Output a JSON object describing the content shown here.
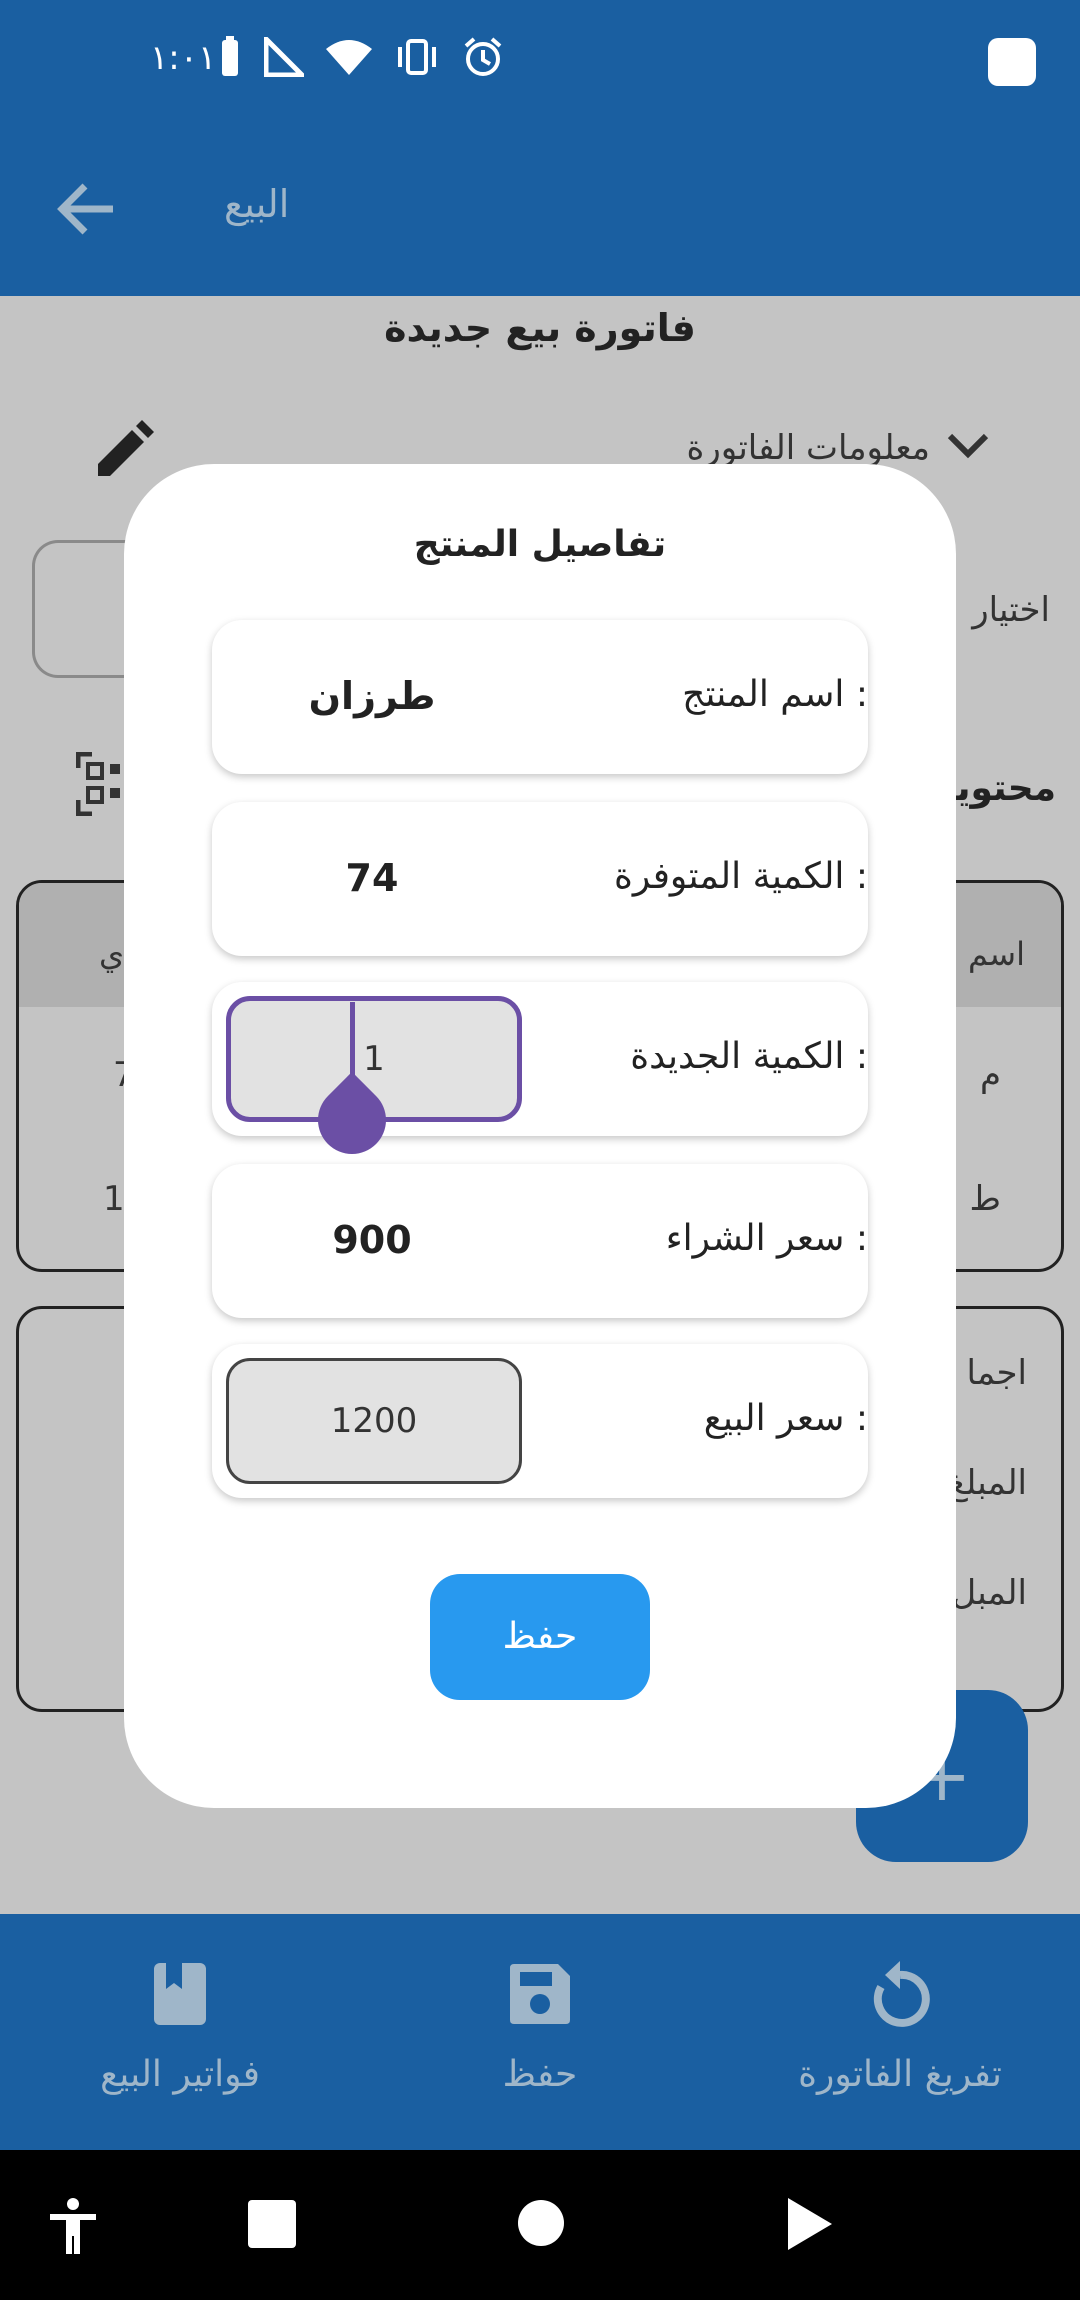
{
  "status_bar": {
    "time": "١:٠١"
  },
  "app_bar": {
    "title": "البيع"
  },
  "background": {
    "invoice_title": "فاتورة بيع جديدة",
    "invoice_info_label": "معلومات الفاتورة",
    "pick_label": "اختيار",
    "contents_label": "محتويا",
    "table": {
      "header_right": "اسم",
      "header_left": "ي",
      "rows": [
        {
          "right": "م",
          "left": "7"
        },
        {
          "right": "ط",
          "left": "1"
        }
      ]
    },
    "totals": [
      "اجما",
      "المبلغ",
      "المبل"
    ],
    "fab_label": "+"
  },
  "modal": {
    "title": "تفاصيل المنتج",
    "product_name_label": "اسم المنتج :",
    "product_name_value": "طرزان",
    "available_qty_label": "الكمية المتوفرة :",
    "available_qty_value": "74",
    "new_qty_label": "الكمية الجديدة :",
    "new_qty_value": "1",
    "purchase_price_label": "سعر الشراء  :",
    "purchase_price_value": "900",
    "sale_price_label": "سعر البيع  :",
    "sale_price_value": "1200",
    "save_label": "حفظ"
  },
  "bottom_nav": {
    "items": [
      {
        "label": "فواتير البيع",
        "icon": "book-icon"
      },
      {
        "label": "حفظ",
        "icon": "save-icon"
      },
      {
        "label": "تفريغ الفاتورة",
        "icon": "refresh-icon"
      }
    ]
  },
  "colors": {
    "primary": "#1a5fa1",
    "accent": "#2899ef",
    "cursor": "#6b4fa5"
  }
}
